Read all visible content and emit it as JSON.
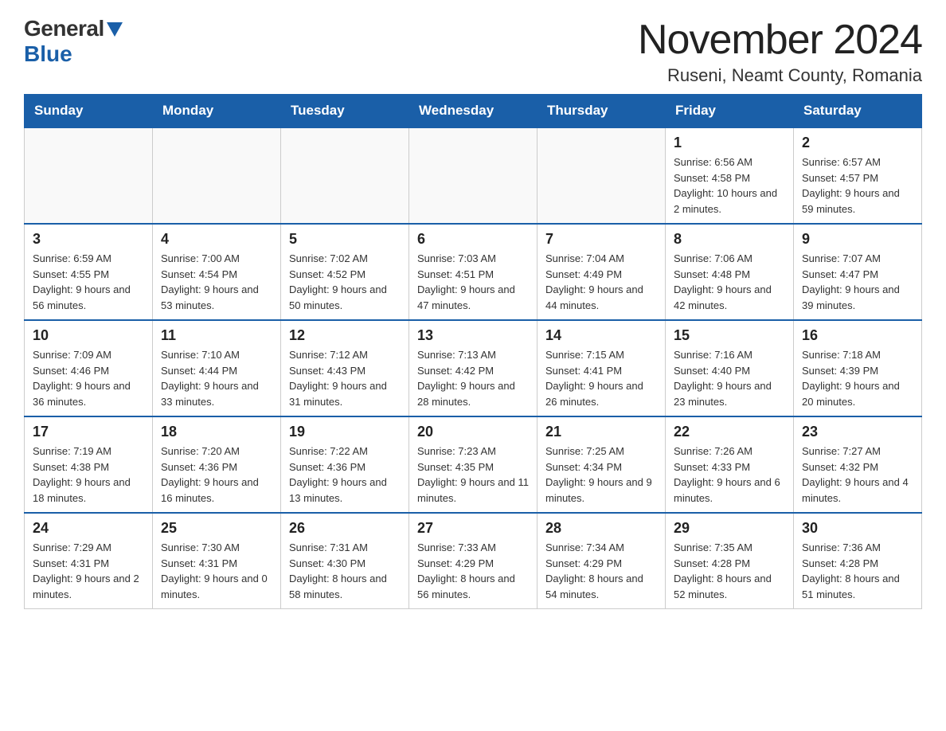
{
  "header": {
    "logo_general": "General",
    "logo_blue": "Blue",
    "month_title": "November 2024",
    "location": "Ruseni, Neamt County, Romania"
  },
  "days_of_week": [
    "Sunday",
    "Monday",
    "Tuesday",
    "Wednesday",
    "Thursday",
    "Friday",
    "Saturday"
  ],
  "weeks": [
    [
      {
        "day": "",
        "info": ""
      },
      {
        "day": "",
        "info": ""
      },
      {
        "day": "",
        "info": ""
      },
      {
        "day": "",
        "info": ""
      },
      {
        "day": "",
        "info": ""
      },
      {
        "day": "1",
        "info": "Sunrise: 6:56 AM\nSunset: 4:58 PM\nDaylight: 10 hours and 2 minutes."
      },
      {
        "day": "2",
        "info": "Sunrise: 6:57 AM\nSunset: 4:57 PM\nDaylight: 9 hours and 59 minutes."
      }
    ],
    [
      {
        "day": "3",
        "info": "Sunrise: 6:59 AM\nSunset: 4:55 PM\nDaylight: 9 hours and 56 minutes."
      },
      {
        "day": "4",
        "info": "Sunrise: 7:00 AM\nSunset: 4:54 PM\nDaylight: 9 hours and 53 minutes."
      },
      {
        "day": "5",
        "info": "Sunrise: 7:02 AM\nSunset: 4:52 PM\nDaylight: 9 hours and 50 minutes."
      },
      {
        "day": "6",
        "info": "Sunrise: 7:03 AM\nSunset: 4:51 PM\nDaylight: 9 hours and 47 minutes."
      },
      {
        "day": "7",
        "info": "Sunrise: 7:04 AM\nSunset: 4:49 PM\nDaylight: 9 hours and 44 minutes."
      },
      {
        "day": "8",
        "info": "Sunrise: 7:06 AM\nSunset: 4:48 PM\nDaylight: 9 hours and 42 minutes."
      },
      {
        "day": "9",
        "info": "Sunrise: 7:07 AM\nSunset: 4:47 PM\nDaylight: 9 hours and 39 minutes."
      }
    ],
    [
      {
        "day": "10",
        "info": "Sunrise: 7:09 AM\nSunset: 4:46 PM\nDaylight: 9 hours and 36 minutes."
      },
      {
        "day": "11",
        "info": "Sunrise: 7:10 AM\nSunset: 4:44 PM\nDaylight: 9 hours and 33 minutes."
      },
      {
        "day": "12",
        "info": "Sunrise: 7:12 AM\nSunset: 4:43 PM\nDaylight: 9 hours and 31 minutes."
      },
      {
        "day": "13",
        "info": "Sunrise: 7:13 AM\nSunset: 4:42 PM\nDaylight: 9 hours and 28 minutes."
      },
      {
        "day": "14",
        "info": "Sunrise: 7:15 AM\nSunset: 4:41 PM\nDaylight: 9 hours and 26 minutes."
      },
      {
        "day": "15",
        "info": "Sunrise: 7:16 AM\nSunset: 4:40 PM\nDaylight: 9 hours and 23 minutes."
      },
      {
        "day": "16",
        "info": "Sunrise: 7:18 AM\nSunset: 4:39 PM\nDaylight: 9 hours and 20 minutes."
      }
    ],
    [
      {
        "day": "17",
        "info": "Sunrise: 7:19 AM\nSunset: 4:38 PM\nDaylight: 9 hours and 18 minutes."
      },
      {
        "day": "18",
        "info": "Sunrise: 7:20 AM\nSunset: 4:36 PM\nDaylight: 9 hours and 16 minutes."
      },
      {
        "day": "19",
        "info": "Sunrise: 7:22 AM\nSunset: 4:36 PM\nDaylight: 9 hours and 13 minutes."
      },
      {
        "day": "20",
        "info": "Sunrise: 7:23 AM\nSunset: 4:35 PM\nDaylight: 9 hours and 11 minutes."
      },
      {
        "day": "21",
        "info": "Sunrise: 7:25 AM\nSunset: 4:34 PM\nDaylight: 9 hours and 9 minutes."
      },
      {
        "day": "22",
        "info": "Sunrise: 7:26 AM\nSunset: 4:33 PM\nDaylight: 9 hours and 6 minutes."
      },
      {
        "day": "23",
        "info": "Sunrise: 7:27 AM\nSunset: 4:32 PM\nDaylight: 9 hours and 4 minutes."
      }
    ],
    [
      {
        "day": "24",
        "info": "Sunrise: 7:29 AM\nSunset: 4:31 PM\nDaylight: 9 hours and 2 minutes."
      },
      {
        "day": "25",
        "info": "Sunrise: 7:30 AM\nSunset: 4:31 PM\nDaylight: 9 hours and 0 minutes."
      },
      {
        "day": "26",
        "info": "Sunrise: 7:31 AM\nSunset: 4:30 PM\nDaylight: 8 hours and 58 minutes."
      },
      {
        "day": "27",
        "info": "Sunrise: 7:33 AM\nSunset: 4:29 PM\nDaylight: 8 hours and 56 minutes."
      },
      {
        "day": "28",
        "info": "Sunrise: 7:34 AM\nSunset: 4:29 PM\nDaylight: 8 hours and 54 minutes."
      },
      {
        "day": "29",
        "info": "Sunrise: 7:35 AM\nSunset: 4:28 PM\nDaylight: 8 hours and 52 minutes."
      },
      {
        "day": "30",
        "info": "Sunrise: 7:36 AM\nSunset: 4:28 PM\nDaylight: 8 hours and 51 minutes."
      }
    ]
  ]
}
